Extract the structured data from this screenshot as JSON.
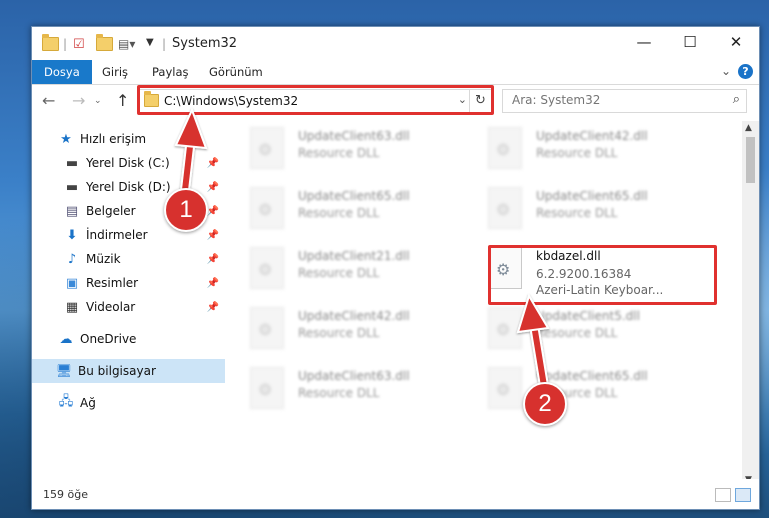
{
  "window": {
    "title": "System32",
    "controls": {
      "minimize": "—",
      "maximize": "☐",
      "close": "✕"
    }
  },
  "ribbon": {
    "tabs": [
      "Dosya",
      "Giriş",
      "Paylaş",
      "Görünüm"
    ],
    "active_tab": "Dosya",
    "help": "?"
  },
  "navigation": {
    "address": "C:\\Windows\\System32",
    "search_placeholder": "Ara: System32"
  },
  "sidebar": {
    "quick_access": "Hızlı erişim",
    "items": [
      {
        "label": "Yerel Disk (C:)",
        "icon": "drive-icon",
        "pinned": true
      },
      {
        "label": "Yerel Disk (D:)",
        "icon": "drive-icon",
        "pinned": true
      },
      {
        "label": "Belgeler",
        "icon": "document-icon",
        "pinned": true
      },
      {
        "label": "İndirmeler",
        "icon": "download-icon",
        "pinned": true
      },
      {
        "label": "Müzik",
        "icon": "music-icon",
        "pinned": true
      },
      {
        "label": "Resimler",
        "icon": "pictures-icon",
        "pinned": true
      },
      {
        "label": "Videolar",
        "icon": "video-icon",
        "pinned": true
      }
    ],
    "onedrive": "OneDrive",
    "this_pc": "Bu bilgisayar",
    "network": "Ağ"
  },
  "files": [
    {
      "name": "UpdateClient63.dll",
      "desc": "Resource DLL"
    },
    {
      "name": "UpdateClient42.dll",
      "desc": "Resource DLL"
    },
    {
      "name": "UpdateClient65.dll",
      "desc": "Resource DLL"
    },
    {
      "name": "UpdateClient65.dll",
      "desc": "Resource DLL"
    },
    {
      "name": "UpdateClient21.dll",
      "desc": "Resource DLL"
    },
    {
      "name": "kbdazel.dll",
      "desc": "6.2.9200.16384",
      "desc2": "Azeri-Latin Keyboar..."
    },
    {
      "name": "UpdateClient42.dll",
      "desc": "Resource DLL"
    },
    {
      "name": "UpdateClient5.dll",
      "desc": "Resource DLL"
    },
    {
      "name": "UpdateClient63.dll",
      "desc": "Resource DLL"
    },
    {
      "name": "UpdateClient65.dll",
      "desc": "Resource DLL"
    }
  ],
  "status": {
    "item_count": "159 öğe"
  },
  "annotations": {
    "step1": "1",
    "step2": "2",
    "highlight_color": "#e0312f"
  }
}
